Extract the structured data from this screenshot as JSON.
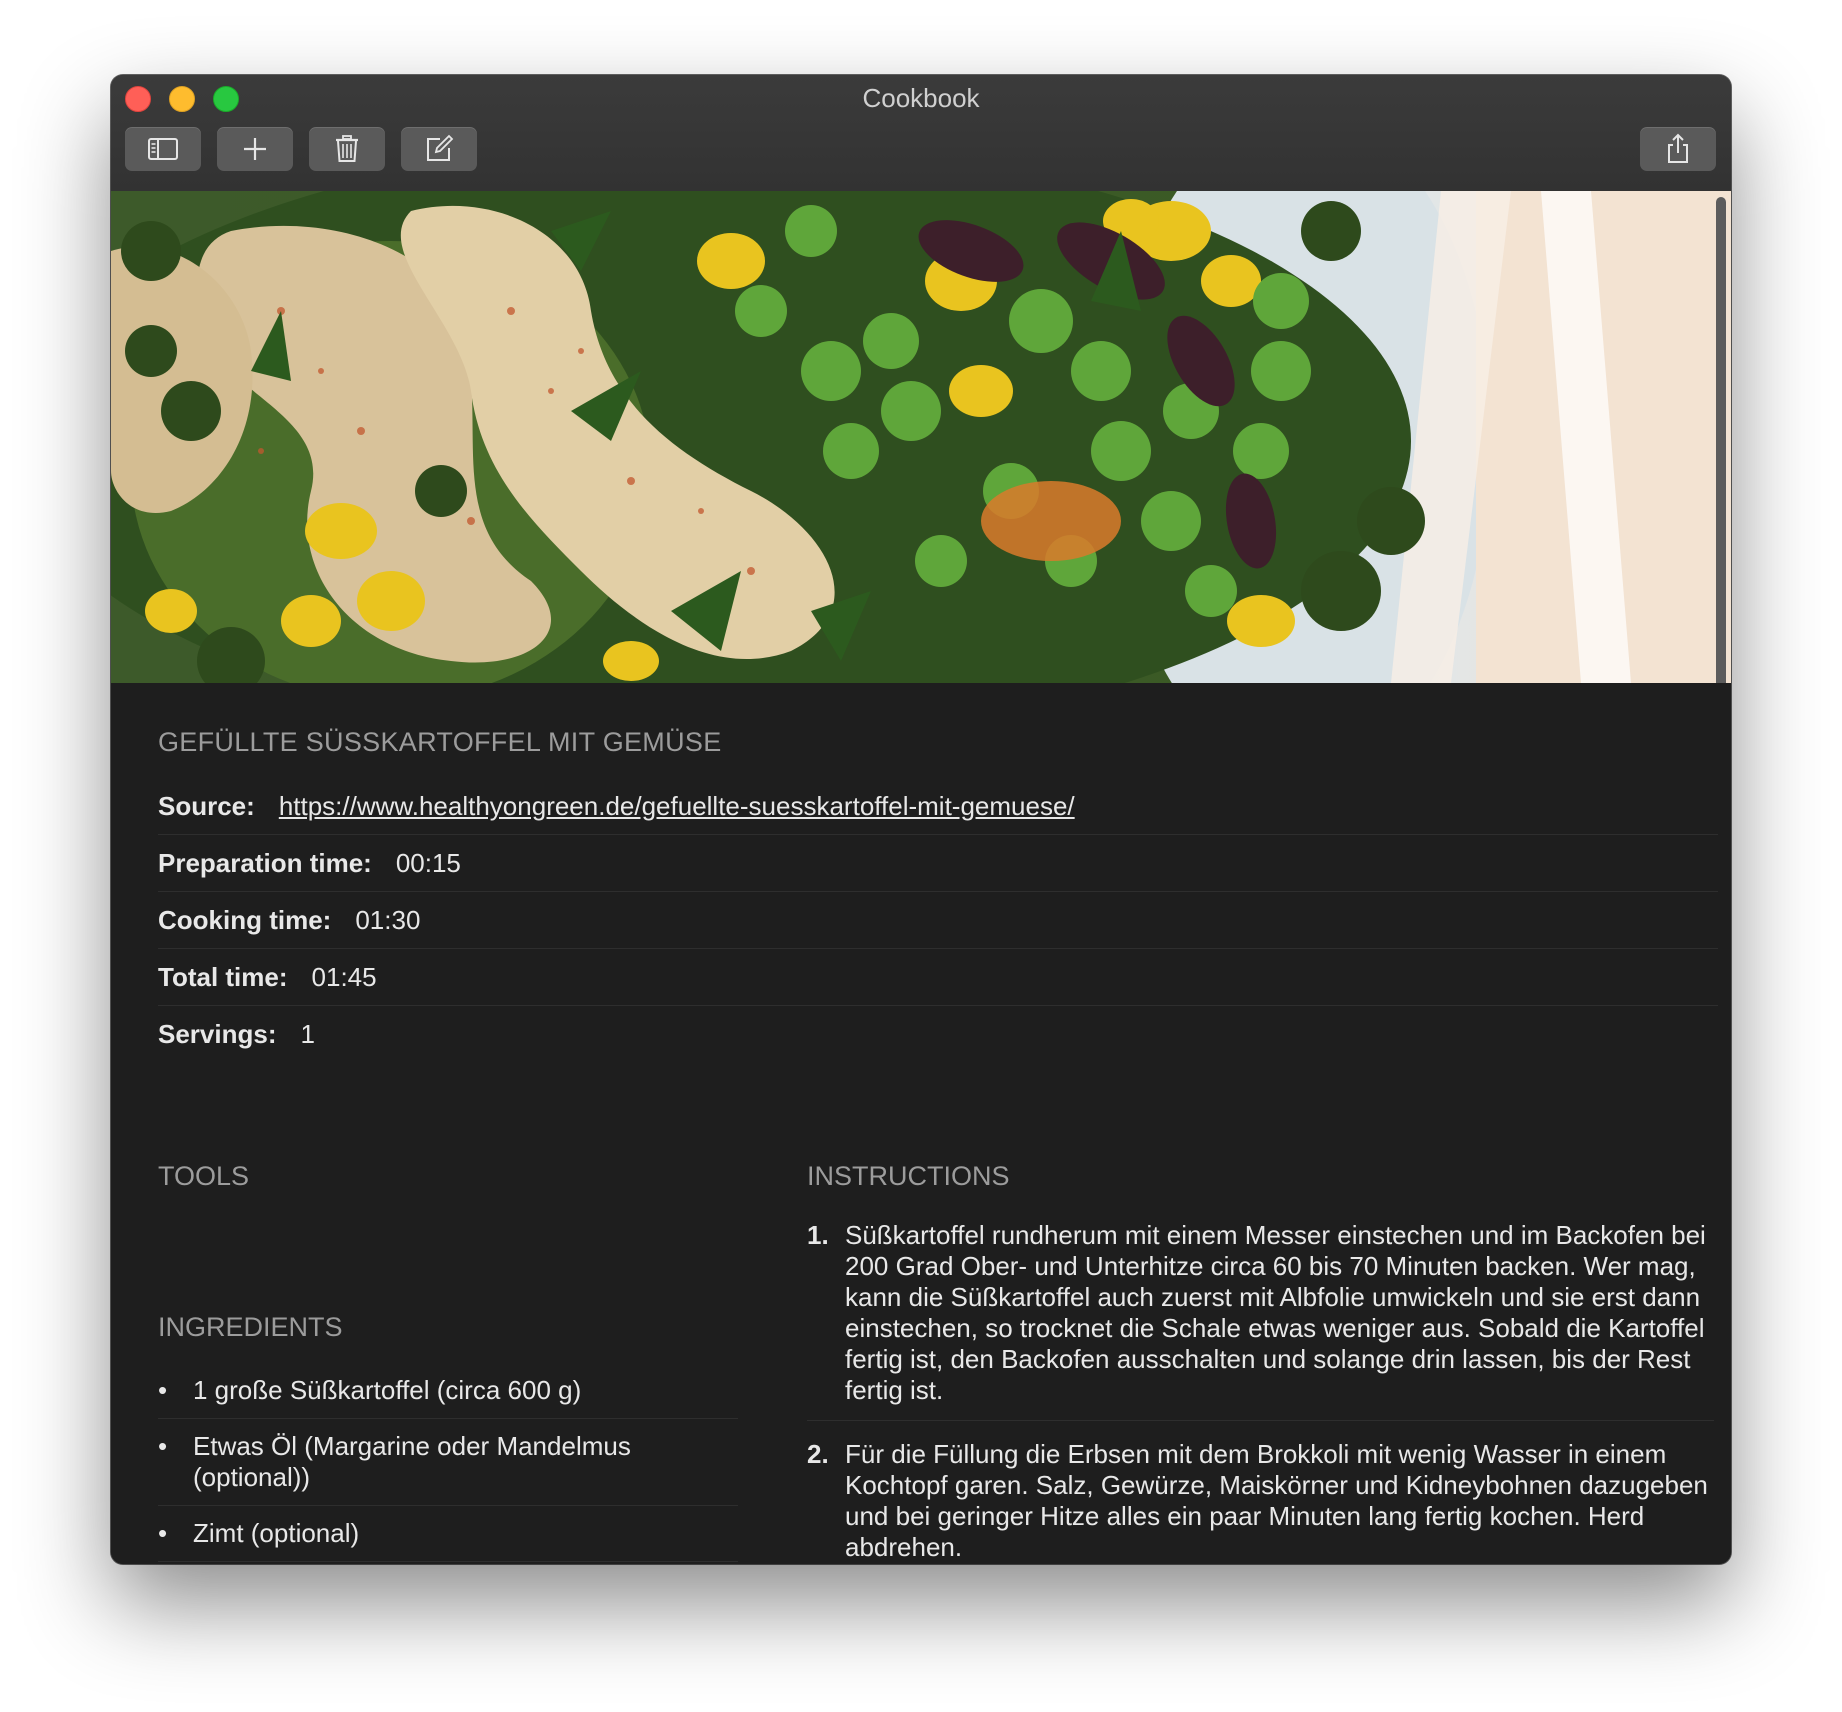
{
  "window": {
    "title": "Cookbook"
  },
  "toolbar": {
    "sidebar_icon": "sidebar-icon",
    "add_icon": "plus-icon",
    "delete_icon": "trash-icon",
    "edit_icon": "compose-icon",
    "share_icon": "share-icon"
  },
  "recipe": {
    "title": "GEFÜLLTE SÜSSKARTOFFEL MIT GEMÜSE",
    "source_label": "Source:",
    "source_url": "https://www.healthyongreen.de/gefuellte-suesskartoffel-mit-gemuese/",
    "prep_label": "Preparation time:",
    "prep_value": "00:15",
    "cook_label": "Cooking time:",
    "cook_value": "01:30",
    "total_label": "Total time:",
    "total_value": "01:45",
    "servings_label": "Servings:",
    "servings_value": "1"
  },
  "sections": {
    "tools": "TOOLS",
    "ingredients": "INGREDIENTS",
    "instructions": "INSTRUCTIONS"
  },
  "ingredients": [
    "1  große Süßkartoffel (circa 600 g)",
    "Etwas Öl (Margarine oder Mandelmus (optional))",
    "Zimt (optional)"
  ],
  "instructions": [
    {
      "num": "1.",
      "text": "Süßkartoffel rundherum mit einem Messer einstechen und im Backofen bei 200 Grad Ober- und Unterhitze circa 60 bis 70 Minuten backen. Wer mag, kann die Süßkartoffel auch zuerst mit Albfolie umwickeln und sie erst dann einstechen, so trocknet die Schale etwas weniger aus. Sobald die Kartoffel fertig ist, den Backofen ausschalten und solange drin lassen, bis der Rest fertig ist."
    },
    {
      "num": "2.",
      "text": "Für die Füllung die Erbsen mit dem Brokkoli mit wenig Wasser in einem Kochtopf garen. Salz, Gewürze, Maiskörner und Kidneybohnen dazugeben und bei geringer Hitze alles ein paar Minuten lang fertig kochen. Herd abdrehen."
    }
  ],
  "colors": {
    "background": "#1e1e1e",
    "titlebar": "#353535",
    "text": "#e8e8e8",
    "muted": "#9c9c9c"
  }
}
